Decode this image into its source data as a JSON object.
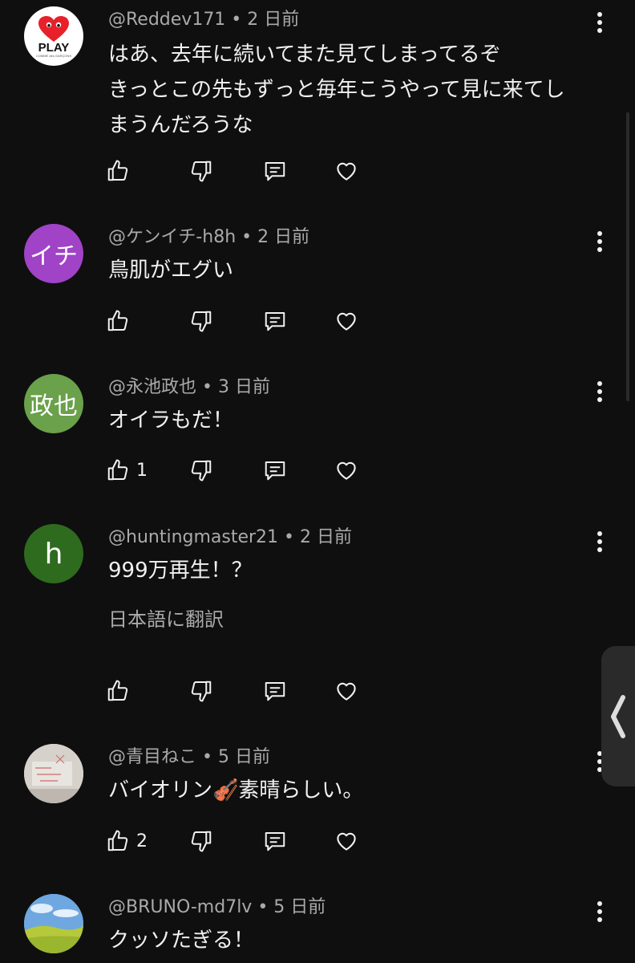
{
  "comments": [
    {
      "meta": "@Reddev171 • 2 日前",
      "lines": [
        "はあ、去年に続いてまた見てしまってるぞ",
        "きっとこの先もずっと毎年こうやって見に来てし",
        "まうんだろうな"
      ],
      "likes": "",
      "avatar_text": "PLAY",
      "avatar_subtext": "COMME des GARÇONS",
      "avatar_color": "#ffffff"
    },
    {
      "meta": "@ケンイチ-h8h • 2 日前",
      "lines": [
        "鳥肌がエグい"
      ],
      "likes": "",
      "avatar_text": "イチ",
      "avatar_color": "#a043c7"
    },
    {
      "meta": "@永池政也 • 3 日前",
      "lines": [
        "オイラもだ！"
      ],
      "likes": "1",
      "avatar_text": "政也",
      "avatar_color": "#6aa14a"
    },
    {
      "meta": "@huntingmaster21 • 2 日前",
      "lines": [
        "999万再生！？"
      ],
      "translate": "日本語に翻訳",
      "likes": "",
      "avatar_text": "h",
      "avatar_color": "#2e6b1e"
    },
    {
      "meta": "@青目ねこ • 5 日前",
      "lines": [
        "バイオリン🎻素晴らしい。"
      ],
      "likes": "2",
      "avatar_text": "",
      "avatar_color": "#d9d4cf"
    },
    {
      "meta": "@BRUNO-md7lv • 5 日前",
      "lines": [
        "クッソたぎる！"
      ],
      "likes": "",
      "avatar_text": "",
      "avatar_color": "#7fb3e6"
    }
  ],
  "icons": {
    "like": "thumbs-up-icon",
    "dislike": "thumbs-down-icon",
    "reply": "reply-icon",
    "heart": "heart-icon",
    "more": "more-vert-icon",
    "edge": "chevron-left-icon"
  }
}
